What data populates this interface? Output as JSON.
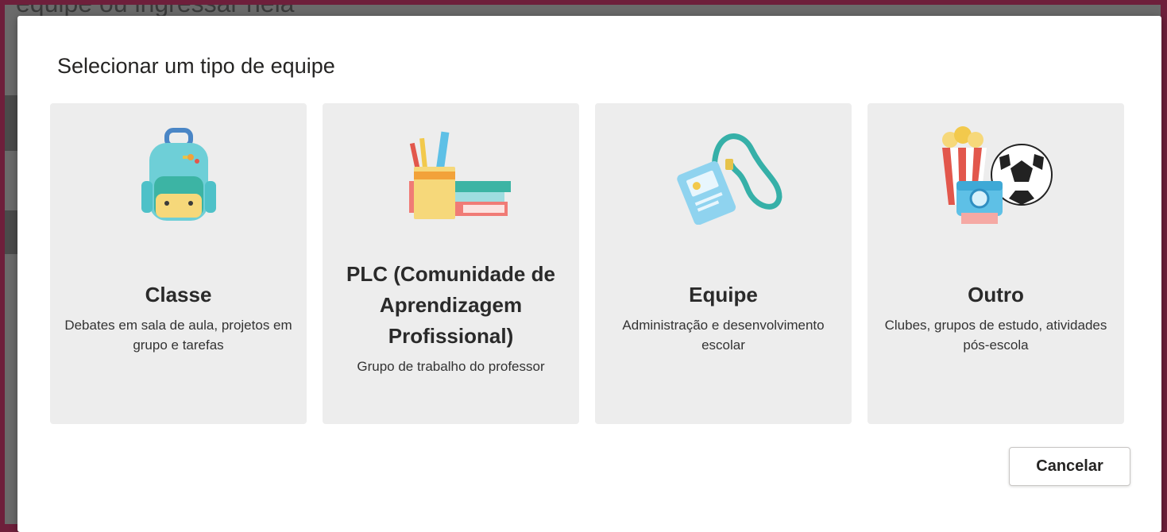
{
  "background": {
    "heading_fragment": "equipe ou ingressar nela"
  },
  "dialog": {
    "title": "Selecionar um tipo de equipe",
    "cards": [
      {
        "title": "Classe",
        "description": "Debates em sala de aula, projetos em grupo e tarefas",
        "icon": "backpack-icon"
      },
      {
        "title": "PLC (Comunidade de Aprendizagem Profissional)",
        "description": "Grupo de trabalho do professor",
        "icon": "pencil-cup-books-icon"
      },
      {
        "title": "Equipe",
        "description": "Administração e desenvolvimento escolar",
        "icon": "lanyard-badge-icon"
      },
      {
        "title": "Outro",
        "description": "Clubes, grupos de estudo, atividades pós-escola",
        "icon": "popcorn-camera-ball-icon"
      }
    ],
    "cancel_label": "Cancelar"
  },
  "colors": {
    "frame": "#6e1f3b",
    "card_bg": "#ededed",
    "teal": "#36b8b0"
  }
}
